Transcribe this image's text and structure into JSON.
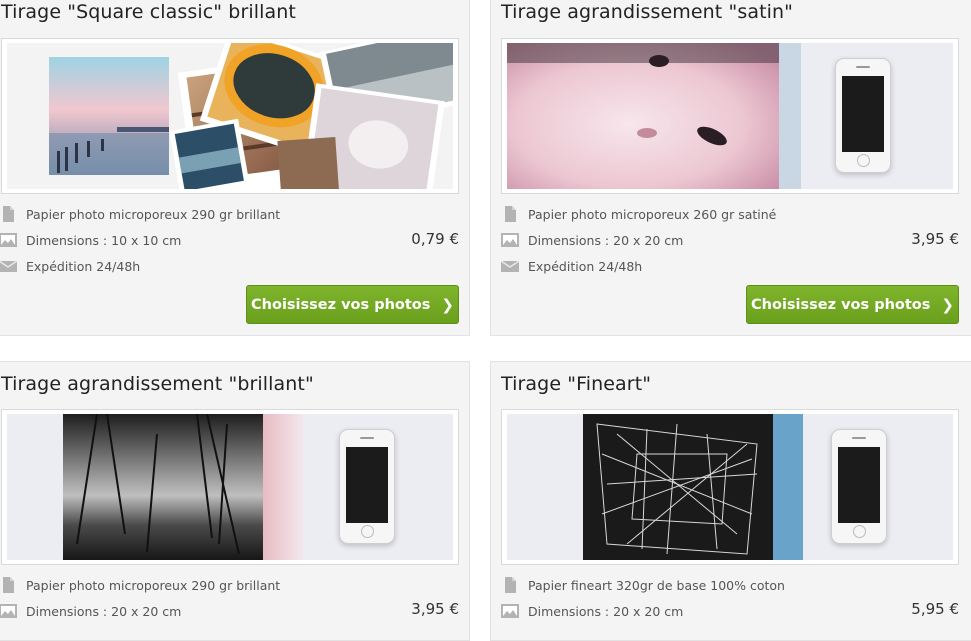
{
  "cards": [
    {
      "title": "Tirage \"Square classic\" brillant",
      "paper": "Papier photo microporeux 290 gr brillant",
      "dimensions": "Dimensions : 10 x 10 cm",
      "shipping": "Expédition 24/48h",
      "price": "0,79 €",
      "button": "Choisissez vos photos"
    },
    {
      "title": "Tirage agrandissement \"satin\"",
      "paper": "Papier photo microporeux 260 gr satiné",
      "dimensions": "Dimensions : 20 x 20 cm",
      "shipping": "Expédition 24/48h",
      "price": "3,95 €",
      "button": "Choisissez vos photos"
    },
    {
      "title": "Tirage agrandissement \"brillant\"",
      "paper": "Papier photo microporeux 290 gr brillant",
      "dimensions": "Dimensions : 20 x 20 cm",
      "price": "3,95 €"
    },
    {
      "title": "Tirage \"Fineart\"",
      "paper": "Papier fineart 320gr de base 100% coton",
      "dimensions": "Dimensions : 20 x 20 cm",
      "price": "5,95 €"
    }
  ],
  "colors": {
    "button": "#72a624",
    "card_bg": "#f4f4f4",
    "icon": "#b3b3b3"
  },
  "icons": [
    "document-icon",
    "image-icon",
    "envelope-icon",
    "chevron-right-icon"
  ]
}
